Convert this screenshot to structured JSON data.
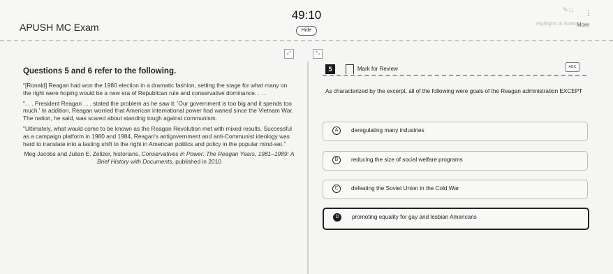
{
  "header": {
    "exam_title": "APUSH MC Exam",
    "timer": "49:10",
    "hide_label": "Hide",
    "highlights_label": "Highlights & Notes",
    "more_label": "More"
  },
  "passage": {
    "heading": "Questions 5 and 6 refer to the following.",
    "paragraphs": [
      "\"[Ronald] Reagan had won the 1980 election in a dramatic fashion, setting the stage for what many on the right were hoping would be a new era of Republican rule and conservative dominance. . . .",
      "\". . . President Reagan . . . stated the problem as he saw it: 'Our government is too big and it spends too much.' In addition, Reagan worried that American international power had waned since the Vietnam War. The nation, he said, was scared about standing tough against communism.",
      "\"Ultimately, what would come to be known as the Reagan Revolution met with mixed results. Successful as a campaign platform in 1980 and 1984, Reagan's antigovernment and anti-Communist ideology was hard to translate into a lasting shift to the right in American politics and policy in the popular mind-set.\""
    ],
    "attribution_authors": "Meg Jacobs and Julian E. Zelizer, historians, ",
    "attribution_book": "Conservatives in Power: The Reagan Years, 1981–1989: A Brief History with Documents",
    "attribution_tail": ", published in 2010"
  },
  "question": {
    "number": "5",
    "mark_label": "Mark for Review",
    "abc_label": "ABC",
    "prompt": "As characterized by the excerpt, all of the following were goals of the Reagan administration EXCEPT",
    "choices": [
      {
        "letter": "A",
        "text": "deregulating many industries"
      },
      {
        "letter": "B",
        "text": "reducing the size of social welfare programs"
      },
      {
        "letter": "C",
        "text": "defeating the Soviet Union in the Cold War"
      },
      {
        "letter": "D",
        "text": "promoting equality for gay and lesbian Americans"
      }
    ],
    "selected": "D"
  }
}
